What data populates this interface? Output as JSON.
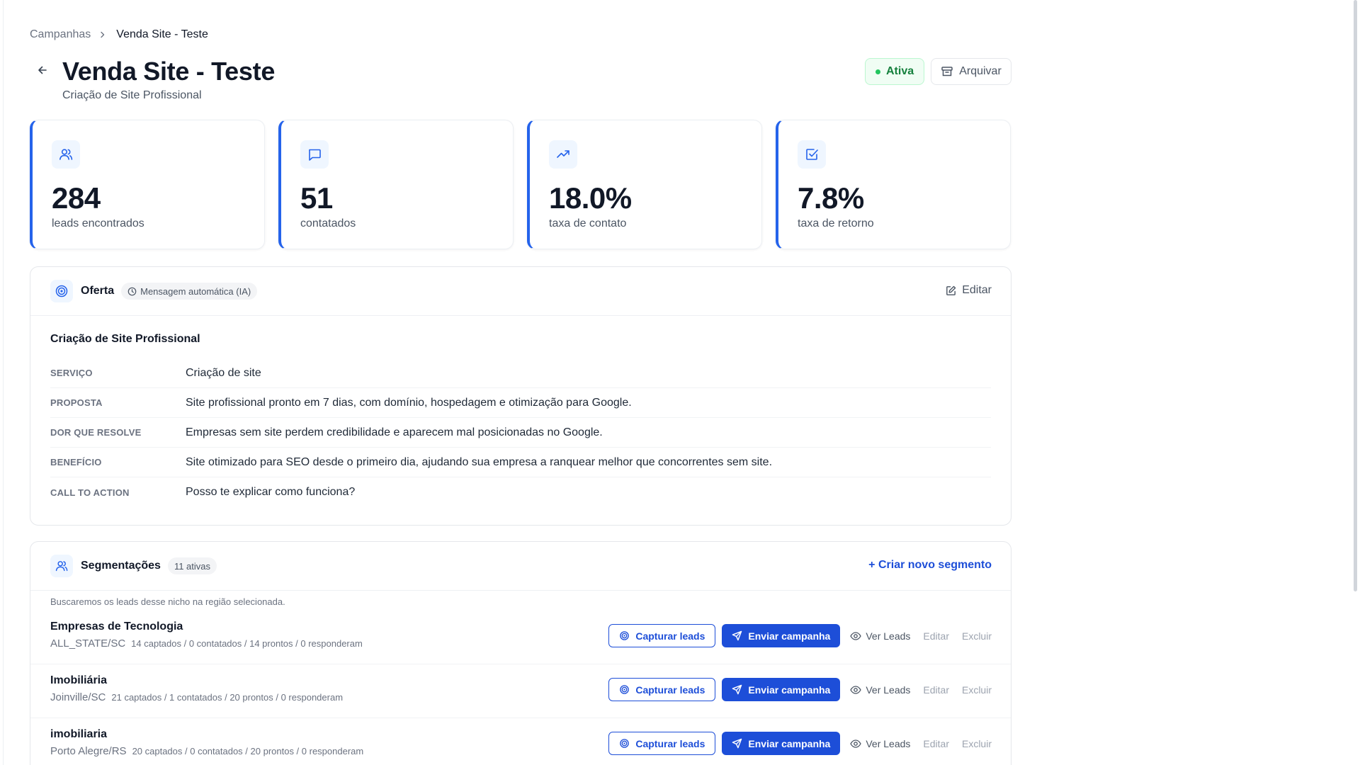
{
  "breadcrumb": {
    "parent": "Campanhas",
    "current": "Venda Site - Teste"
  },
  "header": {
    "title": "Venda Site - Teste",
    "subtitle": "Criação de Site Profissional",
    "status": "Ativa",
    "archive_label": "Arquivar"
  },
  "stats": [
    {
      "icon": "users-icon",
      "value": "284",
      "label": "leads encontrados"
    },
    {
      "icon": "message-icon",
      "value": "51",
      "label": "contatados"
    },
    {
      "icon": "trending-up-icon",
      "value": "18.0%",
      "label": "taxa de contato"
    },
    {
      "icon": "check-square-icon",
      "value": "7.8%",
      "label": "taxa de retorno"
    }
  ],
  "offer": {
    "title": "Oferta",
    "badge": "Mensagem automática (IA)",
    "edit_label": "Editar",
    "name": "Criação de Site Profissional",
    "fields": [
      {
        "key": "SERVIÇO",
        "value": "Criação de site"
      },
      {
        "key": "PROPOSTA",
        "value": "Site profissional pronto em 7 dias, com domínio, hospedagem e otimização para Google."
      },
      {
        "key": "DOR QUE RESOLVE",
        "value": "Empresas sem site perdem credibilidade e aparecem mal posicionadas no Google."
      },
      {
        "key": "BENEFÍCIO",
        "value": "Site otimizado para SEO desde o primeiro dia, ajudando sua empresa a ranquear melhor que concorrentes sem site."
      },
      {
        "key": "CALL TO ACTION",
        "value": "Posso te explicar como funciona?"
      }
    ]
  },
  "segments": {
    "title": "Segmentações",
    "count_badge": "11 ativas",
    "create_label": "+ Criar novo segmento",
    "help_text": "Buscaremos os leads desse nicho na região selecionada.",
    "actions": {
      "capture": "Capturar leads",
      "send": "Enviar campanha",
      "view": "Ver Leads",
      "edit": "Editar",
      "delete": "Excluir"
    },
    "items": [
      {
        "name": "Empresas de Tecnologia",
        "region": "ALL_STATE/SC",
        "stats": "14 captados / 0 contatados / 14 prontos / 0 responderam"
      },
      {
        "name": "Imobiliária",
        "region": "Joinville/SC",
        "stats": "21 captados / 1 contatados / 20 prontos / 0 responderam"
      },
      {
        "name": "imobiliaria",
        "region": "Porto Alegre/RS",
        "stats": "20 captados / 0 contatados / 20 prontos / 0 responderam"
      }
    ]
  },
  "colors": {
    "accent": "#1d4ed8",
    "status_green": "#15803d",
    "card_border_accent": "#2563eb"
  }
}
